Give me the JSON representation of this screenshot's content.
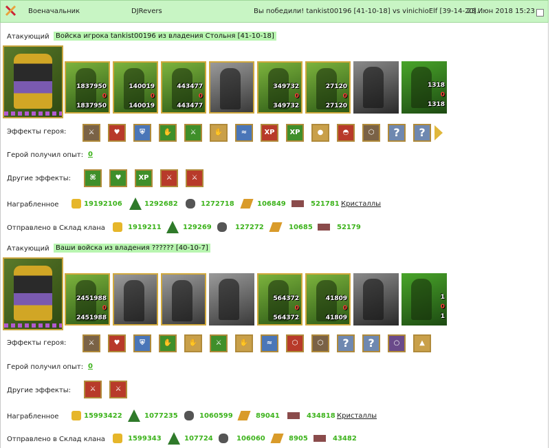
{
  "header": {
    "title": "Военачальник",
    "name": "DJRevers",
    "result": "Вы победили! tankist00196 [41-10-18] vs vinichioElf [39-14-20]...",
    "date": "23 Июн 2018 15:23"
  },
  "blocks": [
    {
      "attacker_label": "Атакующий",
      "attacker_text": "Войска игрока tankist00196 из владения Стольня [41-10-18]",
      "units": [
        {
          "icon": "archer-unit",
          "top": "1837950",
          "mid": "0",
          "bot": "1837950"
        },
        {
          "icon": "swordsman-unit",
          "top": "140019",
          "mid": "0",
          "bot": "140019"
        },
        {
          "icon": "elf-warrior-unit",
          "top": "443477",
          "mid": "0",
          "bot": "443477"
        },
        {
          "icon": "griffin-unit",
          "top": "",
          "mid": "",
          "bot": ""
        },
        {
          "icon": "ranger-unit",
          "top": "349732",
          "mid": "0",
          "bot": "349732"
        },
        {
          "icon": "spear-elf-unit",
          "top": "27120",
          "mid": "0",
          "bot": "27120"
        },
        {
          "icon": "dark-knight-unit",
          "top": "",
          "mid": "",
          "bot": ""
        },
        {
          "icon": "druid-unit",
          "top": "1318",
          "mid": "0",
          "bot": "1318"
        }
      ],
      "effects_label": "Эффекты героя:",
      "effects": [
        "sword-icon",
        "heart-icon",
        "shield-icon",
        "handshake-icon",
        "sword-icon",
        "handshake-icon",
        "water-icon",
        "XP",
        "XP",
        "orb-icon",
        "helmet-icon",
        "armor-icon",
        "?",
        "?"
      ],
      "exp_label": "Герой получил опыт:",
      "exp_value": "0",
      "other_label": "Другие эффекты:",
      "other_effects": [
        "map-icon",
        "heart-icon",
        "XP",
        "sword-icon",
        "sword-icon"
      ],
      "reward_label": "Награбленное",
      "rewards": [
        "19192106",
        "1292682",
        "1272718",
        "106849",
        "521781"
      ],
      "crystals_link": "Кристаллы",
      "sent_label": "Отправлено в Склад клана",
      "sent": [
        "1919211",
        "129269",
        "127272",
        "10685",
        "52179"
      ]
    },
    {
      "attacker_label": "Атакующий",
      "attacker_text": "Ваши войска из владения ?????? [40-10-7]",
      "units": [
        {
          "icon": "archer-unit",
          "top": "2451988",
          "mid": "0",
          "bot": "2451988"
        },
        {
          "icon": "dark-swordsman-unit",
          "top": "",
          "mid": "",
          "bot": ""
        },
        {
          "icon": "dark-elf-unit",
          "top": "",
          "mid": "",
          "bot": ""
        },
        {
          "icon": "griffin-unit",
          "top": "",
          "mid": "",
          "bot": ""
        },
        {
          "icon": "ranger-unit",
          "top": "564372",
          "mid": "0",
          "bot": "564372"
        },
        {
          "icon": "spear-elf-unit",
          "top": "41809",
          "mid": "0",
          "bot": "41809"
        },
        {
          "icon": "dark-knight-unit",
          "top": "",
          "mid": "",
          "bot": ""
        },
        {
          "icon": "druid-unit",
          "top": "1",
          "mid": "0",
          "bot": "1"
        }
      ],
      "effects_label": "Эффекты героя:",
      "effects": [
        "sword-icon",
        "heart-icon",
        "shield-icon",
        "handshake-icon",
        "handshake-icon",
        "sword-icon",
        "handshake-icon",
        "water-icon",
        "armor-icon",
        "armor-icon",
        "?",
        "?",
        "ring-icon",
        "tent-icon"
      ],
      "exp_label": "Герой получил опыт:",
      "exp_value": "0",
      "other_label": "Другие эффекты:",
      "other_effects": [
        "sword-icon",
        "sword-icon"
      ],
      "reward_label": "Награбленное",
      "rewards": [
        "15993422",
        "1077235",
        "1060599",
        "89041",
        "434818"
      ],
      "crystals_link": "Кристаллы",
      "sent_label": "Отправлено в Склад клана",
      "sent": [
        "1599343",
        "107724",
        "106060",
        "8905",
        "43482"
      ]
    }
  ],
  "colors": {
    "header_bg": "#c8f5c4",
    "highlight": "#b8f5b0",
    "value_green": "#3db31c",
    "frame_gold": "#d1a93d"
  }
}
